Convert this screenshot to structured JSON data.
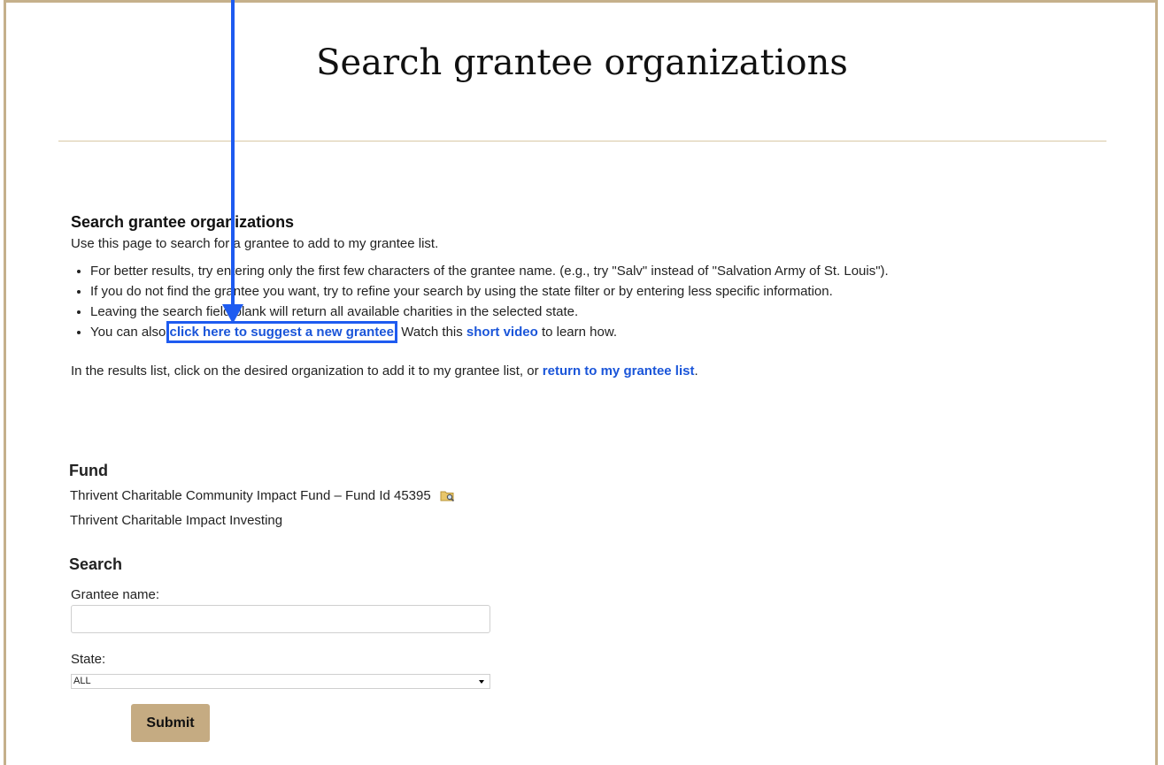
{
  "page": {
    "title": "Search grantee organizations"
  },
  "intro": {
    "heading": "Search grantee organizations",
    "text": "Use this page to search for a grantee to add to my grantee list.",
    "bullets": [
      "For better results, try entering only the first few characters of the grantee name. (e.g., try \"Salv\" instead of \"Salvation Army of St. Louis\").",
      "If you do not find the grantee you want, try to refine your search by using the state filter or by entering less specific information.",
      "Leaving the search field blank will return all available charities in the selected state."
    ],
    "suggest": {
      "prefix": "You can also ",
      "link": "click here to suggest a new grantee",
      "middle": ". Watch this ",
      "video_link": "short video",
      "suffix": " to learn how."
    }
  },
  "results_note": {
    "prefix": "In the results list, click on the desired organization to add it to my grantee list, or ",
    "link": "return to my grantee list",
    "suffix": "."
  },
  "fund": {
    "heading": "Fund",
    "name": "Thrivent Charitable Community Impact Fund – Fund Id 45395",
    "program": "Thrivent Charitable Impact Investing",
    "icon": "folder-search-icon"
  },
  "search": {
    "heading": "Search",
    "grantee_label": "Grantee name:",
    "grantee_value": "",
    "state_label": "State:",
    "state_value": "ALL",
    "submit_label": "Submit"
  },
  "colors": {
    "accent": "#c5ab82",
    "link": "#1a55d9",
    "annotation": "#1e5bf0"
  }
}
